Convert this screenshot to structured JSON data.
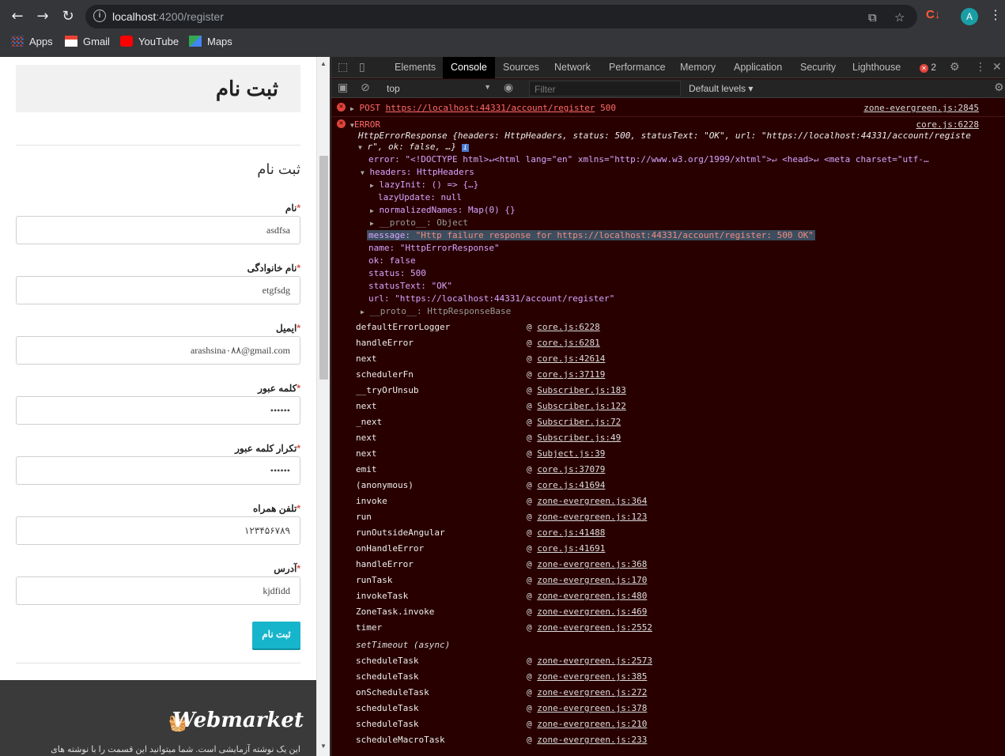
{
  "browser": {
    "url_host": "localhost",
    "url_rest": ":4200/register",
    "bookmarks": [
      "Apps",
      "Gmail",
      "YouTube",
      "Maps"
    ],
    "avatar_letter": "A",
    "ext_label": "C↓"
  },
  "page": {
    "header_title": "ثبت نام",
    "section_title": "ثبت نام",
    "fields": [
      {
        "label": "نام",
        "value": "asdfsa"
      },
      {
        "label": "نام خانوادگی",
        "value": "etgfsdg"
      },
      {
        "label": "ایمیل",
        "value": "arashsina۰۸۸@gmail.com"
      },
      {
        "label": "کلمه عبور",
        "value": "••••••"
      },
      {
        "label": "تکرار کلمه عبور",
        "value": "••••••"
      },
      {
        "label": "تلفن همراه",
        "value": "۱۲۳۴۵۶۷۸۹"
      },
      {
        "label": "آدرس",
        "value": "kjdfidd"
      }
    ],
    "required_mark": "*",
    "submit_label": "ثبت نام",
    "footer_brand": "Webmarket",
    "footer_text": "این یک نوشته آزمایشی است. شما میتوانید این قسمت را با نوشته های"
  },
  "devtools": {
    "tabs": [
      "Elements",
      "Console",
      "Sources",
      "Network",
      "Performance",
      "Memory",
      "Application",
      "Security",
      "Lighthouse"
    ],
    "active_tab": "Console",
    "error_count": "2",
    "context": "top",
    "filter_placeholder": "Filter",
    "levels": "Default levels",
    "post_line": {
      "method": "POST",
      "url": "https://localhost:44331/account/register",
      "status": "500",
      "source": "zone-evergreen.js:2845"
    },
    "error_line": {
      "label": "ERROR",
      "source": "core.js:6228",
      "summary_1": "HttpErrorResponse {headers: HttpHeaders, status: 500, statusText: \"OK\", url: \"https://localhost:44331/account/registe",
      "summary_2": "r\", ok: false, …}",
      "error_prop": "error: \"<!DOCTYPE html>↵<html lang=\"en\" xmlns=\"http://www.w3.org/1999/xhtml\">↵    <head>↵        <meta charset=\"utf-…",
      "headers": "headers: HttpHeaders",
      "lazyInit": "lazyInit: () => {…}",
      "lazyUpdate": "lazyUpdate: null",
      "normalizedNames": "normalizedNames: Map(0) {}",
      "proto1": "__proto__: Object",
      "message_key": "message: ",
      "message_val": "\"Http failure response for https://localhost:44331/account/register: 500 OK\"",
      "name": "name: \"HttpErrorResponse\"",
      "ok": "ok: false",
      "status": "status: 500",
      "statusText": "statusText: \"OK\"",
      "url": "url: \"https://localhost:44331/account/register\"",
      "proto2": "__proto__: HttpResponseBase"
    },
    "stack": [
      {
        "fn": "defaultErrorLogger",
        "src": "core.js:6228"
      },
      {
        "fn": "handleError",
        "src": "core.js:6281"
      },
      {
        "fn": "next",
        "src": "core.js:42614"
      },
      {
        "fn": "schedulerFn",
        "src": "core.js:37119"
      },
      {
        "fn": "__tryOrUnsub",
        "src": "Subscriber.js:183"
      },
      {
        "fn": "next",
        "src": "Subscriber.js:122"
      },
      {
        "fn": "_next",
        "src": "Subscriber.js:72"
      },
      {
        "fn": "next",
        "src": "Subscriber.js:49"
      },
      {
        "fn": "next",
        "src": "Subject.js:39"
      },
      {
        "fn": "emit",
        "src": "core.js:37079"
      },
      {
        "fn": "(anonymous)",
        "src": "core.js:41694"
      },
      {
        "fn": "invoke",
        "src": "zone-evergreen.js:364"
      },
      {
        "fn": "run",
        "src": "zone-evergreen.js:123"
      },
      {
        "fn": "runOutsideAngular",
        "src": "core.js:41488"
      },
      {
        "fn": "onHandleError",
        "src": "core.js:41691"
      },
      {
        "fn": "handleError",
        "src": "zone-evergreen.js:368"
      },
      {
        "fn": "runTask",
        "src": "zone-evergreen.js:170"
      },
      {
        "fn": "invokeTask",
        "src": "zone-evergreen.js:480"
      },
      {
        "fn": "ZoneTask.invoke",
        "src": "zone-evergreen.js:469"
      },
      {
        "fn": "timer",
        "src": "zone-evergreen.js:2552"
      }
    ],
    "async_label": "setTimeout (async)",
    "stack2": [
      {
        "fn": "scheduleTask",
        "src": "zone-evergreen.js:2573"
      },
      {
        "fn": "scheduleTask",
        "src": "zone-evergreen.js:385"
      },
      {
        "fn": "onScheduleTask",
        "src": "zone-evergreen.js:272"
      },
      {
        "fn": "scheduleTask",
        "src": "zone-evergreen.js:378"
      },
      {
        "fn": "scheduleTask",
        "src": "zone-evergreen.js:210"
      },
      {
        "fn": "scheduleMacroTask",
        "src": "zone-evergreen.js:233"
      }
    ],
    "at_sign": "@"
  }
}
